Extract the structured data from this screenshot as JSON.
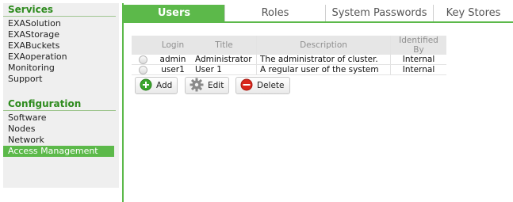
{
  "sidebar": {
    "sections": [
      {
        "title": "Services",
        "items": [
          "EXASolution",
          "EXAStorage",
          "EXABuckets",
          "EXAoperation",
          "Monitoring",
          "Support"
        ]
      },
      {
        "title": "Configuration",
        "items": [
          "Software",
          "Nodes",
          "Network",
          "Access Management"
        ]
      }
    ],
    "active_item": "Access Management"
  },
  "tabs": [
    {
      "label": "Users",
      "active": true
    },
    {
      "label": "Roles",
      "active": false
    },
    {
      "label": "System Passwords",
      "active": false
    },
    {
      "label": "Key Stores",
      "active": false
    }
  ],
  "user_table": {
    "columns": [
      "Login",
      "Title",
      "Description",
      "Identified By"
    ],
    "rows": [
      {
        "login": "admin",
        "title": "Administrator",
        "description": "The administrator of cluster.",
        "identified_by": "Internal"
      },
      {
        "login": "user1",
        "title": "User 1",
        "description": "A regular user of the system",
        "identified_by": "Internal"
      }
    ]
  },
  "buttons": {
    "add": {
      "label": "Add",
      "icon": "plus-circle-icon",
      "color": "#3aa62c"
    },
    "edit": {
      "label": "Edit",
      "icon": "gear-icon",
      "color": "#7a7a7a"
    },
    "delete": {
      "label": "Delete",
      "icon": "minus-circle-icon",
      "color": "#d9261c"
    }
  },
  "colors": {
    "accent": "#5cb94a",
    "section_title": "#2e8b1e",
    "sidebar_bg": "#efefef"
  }
}
